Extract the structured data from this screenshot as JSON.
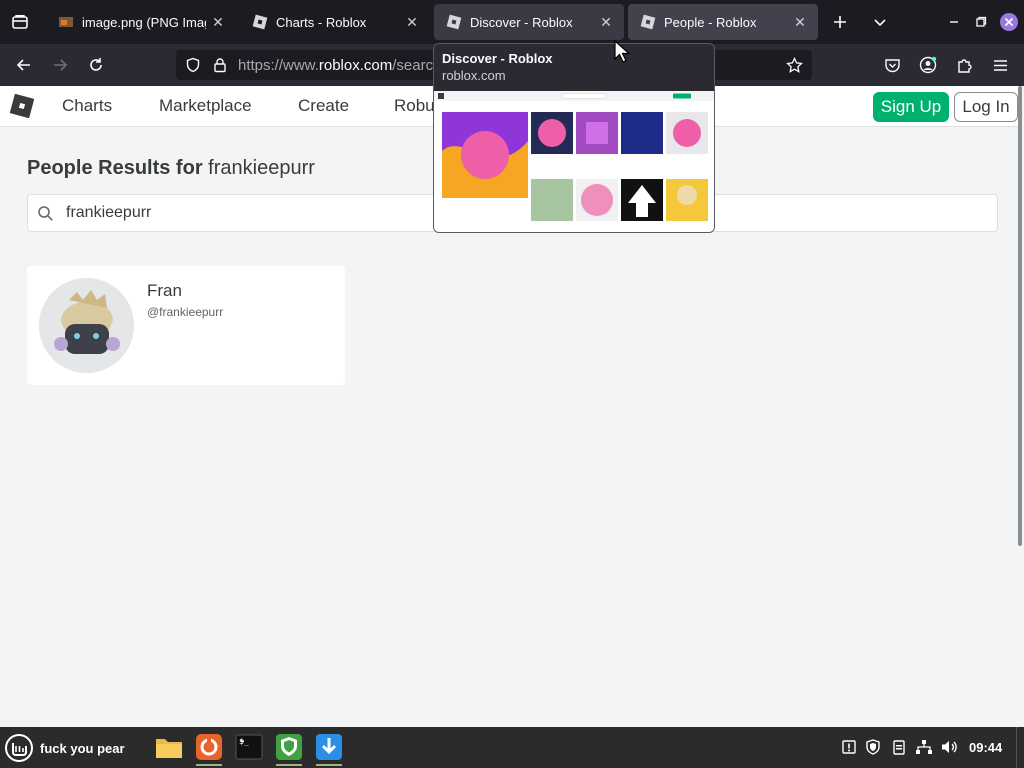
{
  "browser": {
    "tabs": [
      {
        "title": "image.png (PNG Image",
        "close": "✕"
      },
      {
        "title": "Charts - Roblox",
        "close": "✕"
      },
      {
        "title": "Discover - Roblox",
        "close": "✕"
      },
      {
        "title": "People - Roblox",
        "close": "✕"
      }
    ],
    "url_prefix": "https://www.",
    "url_domain": "roblox.com",
    "url_suffix": "/searc"
  },
  "tab_preview": {
    "title": "Discover - Roblox",
    "url": "roblox.com"
  },
  "roblox": {
    "nav": [
      "Charts",
      "Marketplace",
      "Create",
      "Robu"
    ],
    "signup_label": "Sign Up",
    "login_label": "Log In",
    "results_label": "People Results for",
    "results_query": "frankieepurr",
    "search_value": "frankieepurr",
    "result": {
      "display_name": "Fran",
      "username": "@frankieepurr"
    }
  },
  "taskbar": {
    "menu_label": "fuck you pear",
    "clock": "09:44"
  },
  "colors": {
    "signup": "#00b06f",
    "browser_chrome": "#1c1b22",
    "taskbar": "#2b2b2b"
  }
}
